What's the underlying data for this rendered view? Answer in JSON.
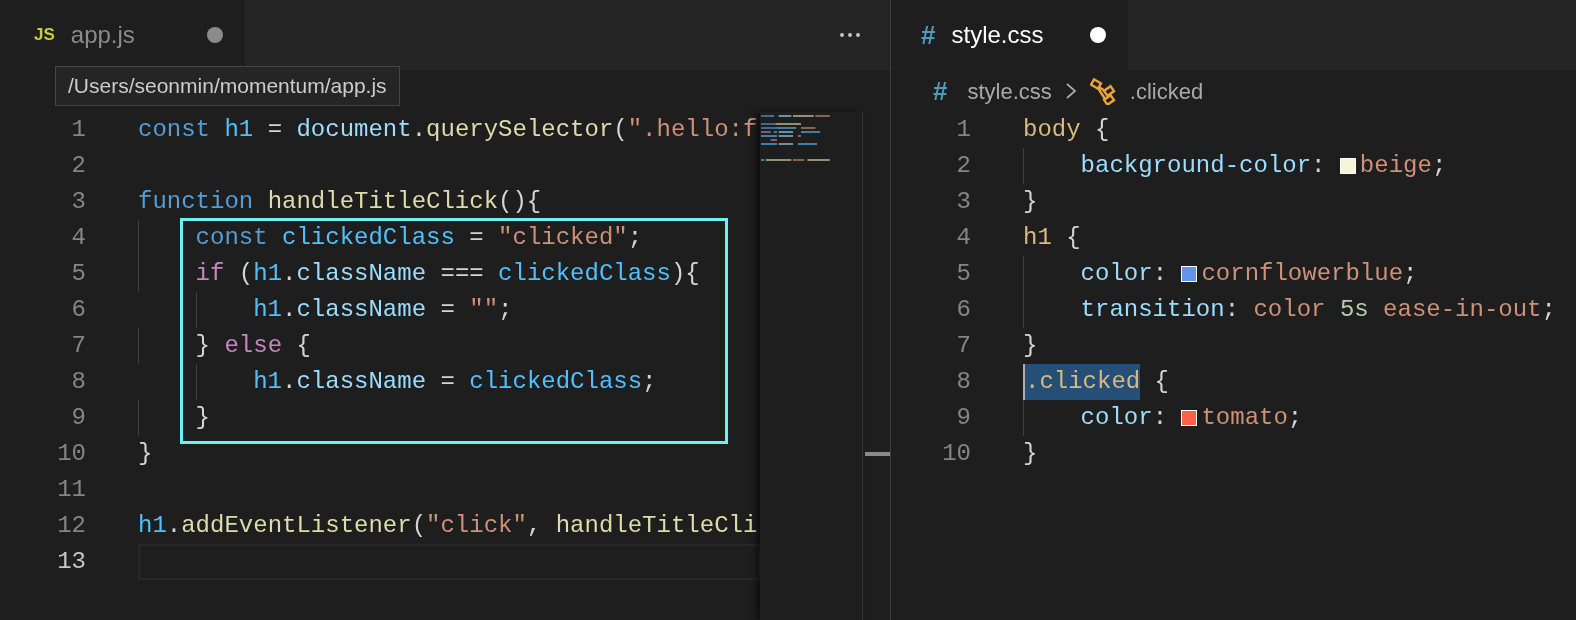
{
  "editors": [
    {
      "tab": {
        "icon": "JS",
        "label": "app.js",
        "selected": false,
        "dirty": true
      },
      "tooltip": "/Users/seonmin/momentum/app.js",
      "minimap": true,
      "lines": [
        {
          "number": "1",
          "active": false,
          "boxed": false,
          "tokens": [
            {
              "text": "const ",
              "kind": "keyword"
            },
            {
              "text": "h1",
              "kind": "const"
            },
            {
              "text": " = ",
              "kind": "plain"
            },
            {
              "text": "document",
              "kind": "var"
            },
            {
              "text": ".",
              "kind": "plain"
            },
            {
              "text": "querySelector",
              "kind": "func"
            },
            {
              "text": "(",
              "kind": "plain"
            },
            {
              "text": "\".hello:f",
              "kind": "string"
            }
          ]
        },
        {
          "number": "2",
          "active": false,
          "boxed": false
        },
        {
          "number": "3",
          "active": false,
          "boxed": false,
          "tokens": [
            {
              "text": "function ",
              "kind": "keyword"
            },
            {
              "text": "handleTitleClick",
              "kind": "func"
            },
            {
              "text": "(){",
              "kind": "plain"
            }
          ]
        },
        {
          "number": "4",
          "active": false,
          "boxed": true,
          "tokens": [
            {
              "text": "    const ",
              "kind": "keyword"
            },
            {
              "text": "clickedClass",
              "kind": "const"
            },
            {
              "text": " = ",
              "kind": "plain"
            },
            {
              "text": "\"clicked\"",
              "kind": "string"
            },
            {
              "text": ";",
              "kind": "plain"
            }
          ]
        },
        {
          "number": "5",
          "active": false,
          "boxed": true,
          "tokens": [
            {
              "text": "    if",
              "kind": "control"
            },
            {
              "text": " (",
              "kind": "plain"
            },
            {
              "text": "h1",
              "kind": "const"
            },
            {
              "text": ".",
              "kind": "plain"
            },
            {
              "text": "className",
              "kind": "var"
            },
            {
              "text": " === ",
              "kind": "plain"
            },
            {
              "text": "clickedClass",
              "kind": "const"
            },
            {
              "text": "){",
              "kind": "plain"
            }
          ]
        },
        {
          "number": "6",
          "active": false,
          "boxed": true,
          "tokens": [
            {
              "text": "        h1",
              "kind": "const"
            },
            {
              "text": ".",
              "kind": "plain"
            },
            {
              "text": "className",
              "kind": "var"
            },
            {
              "text": " = ",
              "kind": "plain"
            },
            {
              "text": "\"\"",
              "kind": "string"
            },
            {
              "text": ";",
              "kind": "plain"
            }
          ]
        },
        {
          "number": "7",
          "active": false,
          "boxed": true,
          "tokens": [
            {
              "text": "    } ",
              "kind": "plain"
            },
            {
              "text": "else",
              "kind": "control"
            },
            {
              "text": " {",
              "kind": "plain"
            }
          ]
        },
        {
          "number": "8",
          "active": false,
          "boxed": true,
          "tokens": [
            {
              "text": "        h1",
              "kind": "const"
            },
            {
              "text": ".",
              "kind": "plain"
            },
            {
              "text": "className",
              "kind": "var"
            },
            {
              "text": " = ",
              "kind": "plain"
            },
            {
              "text": "clickedClass",
              "kind": "const"
            },
            {
              "text": ";",
              "kind": "plain"
            }
          ]
        },
        {
          "number": "9",
          "active": false,
          "boxed": true,
          "tokens": [
            {
              "text": "    }",
              "kind": "plain"
            }
          ]
        },
        {
          "number": "10",
          "active": false,
          "boxed": false,
          "tokens": [
            {
              "text": "}",
              "kind": "plain"
            }
          ]
        },
        {
          "number": "11",
          "active": false,
          "boxed": false
        },
        {
          "number": "12",
          "active": false,
          "boxed": false,
          "tokens": [
            {
              "text": "h1",
              "kind": "const"
            },
            {
              "text": ".",
              "kind": "plain"
            },
            {
              "text": "addEventListener",
              "kind": "func"
            },
            {
              "text": "(",
              "kind": "plain"
            },
            {
              "text": "\"click\"",
              "kind": "string"
            },
            {
              "text": ", ",
              "kind": "plain"
            },
            {
              "text": "handleTitleCli",
              "kind": "func"
            }
          ]
        },
        {
          "number": "13",
          "active": true,
          "boxed": false
        }
      ]
    },
    {
      "tab": {
        "icon": "#",
        "label": "style.css",
        "selected": true,
        "dirty": true
      },
      "breadcrumb": [
        {
          "kind": "file",
          "icon": "#",
          "text": "style.css"
        },
        {
          "kind": "symbol",
          "text": ".clicked"
        }
      ],
      "lines": [
        {
          "number": "1",
          "active": false,
          "boxed": false,
          "tokens": [
            {
              "text": "body",
              "kind": "selector"
            },
            {
              "text": " {",
              "kind": "plain"
            }
          ]
        },
        {
          "number": "2",
          "active": false,
          "boxed": false,
          "tokens": [
            {
              "text": "    background-color",
              "kind": "prop"
            },
            {
              "text": ": ",
              "kind": "plain"
            },
            {
              "kind": "swatch",
              "color": "#f5f5dc"
            },
            {
              "text": "beige",
              "kind": "value"
            },
            {
              "text": ";",
              "kind": "plain"
            }
          ]
        },
        {
          "number": "3",
          "active": false,
          "boxed": false,
          "tokens": [
            {
              "text": "}",
              "kind": "plain"
            }
          ]
        },
        {
          "number": "4",
          "active": false,
          "boxed": false,
          "tokens": [
            {
              "text": "h1",
              "kind": "selector"
            },
            {
              "text": " {",
              "kind": "plain"
            }
          ]
        },
        {
          "number": "5",
          "active": false,
          "boxed": false,
          "tokens": [
            {
              "text": "    color",
              "kind": "prop"
            },
            {
              "text": ": ",
              "kind": "plain"
            },
            {
              "kind": "swatch",
              "color": "#6495ed"
            },
            {
              "text": "cornflowerblue",
              "kind": "value"
            },
            {
              "text": ";",
              "kind": "plain"
            }
          ]
        },
        {
          "number": "6",
          "active": false,
          "boxed": false,
          "tokens": [
            {
              "text": "    transition",
              "kind": "prop"
            },
            {
              "text": ": ",
              "kind": "plain"
            },
            {
              "text": "color ",
              "kind": "value"
            },
            {
              "text": "5s",
              "kind": "number"
            },
            {
              "text": " ease-in-out",
              "kind": "value"
            },
            {
              "text": ";",
              "kind": "plain"
            }
          ]
        },
        {
          "number": "7",
          "active": false,
          "boxed": false,
          "tokens": [
            {
              "text": "}",
              "kind": "plain"
            }
          ]
        },
        {
          "number": "8",
          "active": false,
          "boxed": false,
          "tokens": [
            {
              "text": ".clicked",
              "kind": "selection"
            },
            {
              "text": " {",
              "kind": "plain"
            }
          ]
        },
        {
          "number": "9",
          "active": false,
          "boxed": false,
          "tokens": [
            {
              "text": "    color",
              "kind": "prop"
            },
            {
              "text": ": ",
              "kind": "plain"
            },
            {
              "kind": "swatch",
              "color": "#ff6347"
            },
            {
              "text": "tomato",
              "kind": "value"
            },
            {
              "text": ";",
              "kind": "plain"
            }
          ]
        },
        {
          "number": "10",
          "active": false,
          "boxed": false,
          "tokens": [
            {
              "text": "}",
              "kind": "plain"
            }
          ]
        }
      ]
    }
  ]
}
